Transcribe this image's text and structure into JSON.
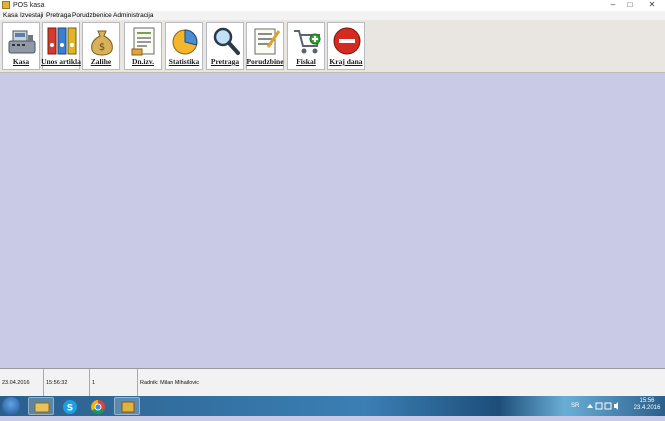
{
  "window": {
    "title": "POS kasa",
    "minimize": "–",
    "maximize": "□",
    "close": "✕"
  },
  "menu": [
    "Kasa",
    "Izvestaji",
    "Pretraga",
    "Porudzbenice",
    "Administracija"
  ],
  "toolbar": [
    {
      "label": "Kasa",
      "icon": "cash-register-icon"
    },
    {
      "label": "Unos artikla",
      "icon": "binders-icon"
    },
    {
      "label": "Zalihe",
      "icon": "money-bag-icon"
    },
    {
      "label": "Dn.izv.",
      "icon": "daily-report-icon"
    },
    {
      "label": "Statistika",
      "icon": "pie-chart-icon"
    },
    {
      "label": "Pretraga",
      "icon": "magnifier-icon"
    },
    {
      "label": "Porudzbine",
      "icon": "order-form-icon"
    },
    {
      "label": "Fiskal",
      "icon": "shopping-cart-icon"
    },
    {
      "label": "Kraj dana",
      "icon": "stop-icon"
    }
  ],
  "status": {
    "date": "23.04.2016",
    "time": "15:56:32",
    "number": "1",
    "worker": "Radnik: Milan Mihailovic"
  },
  "taskbar": {
    "lang": "SR",
    "clock_time": "15:56",
    "clock_date": "23.4.2016"
  },
  "colors": {
    "workspace": "#c8cae6",
    "toolbar": "#e9e6e1"
  }
}
